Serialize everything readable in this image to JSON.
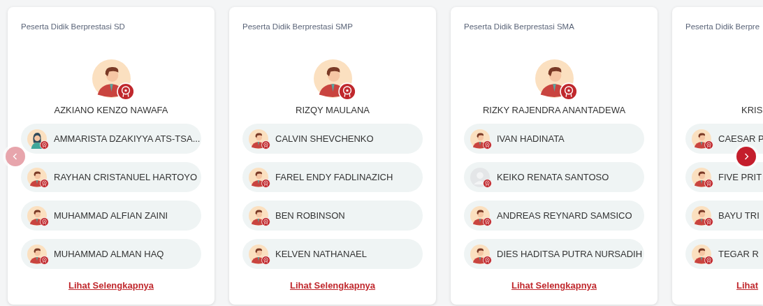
{
  "prev_button": {
    "disabled": true
  },
  "next_button": {
    "disabled": false
  },
  "cards": [
    {
      "title": "Peserta Didik Berprestasi SD",
      "featured": {
        "name": "AZKIANO KENZO NAWAFA",
        "kind": "boy"
      },
      "students": [
        {
          "name": "AMMARISTA DZAKIYYA ATS-TSA...",
          "kind": "girl"
        },
        {
          "name": "RAYHAN CRISTANUEL HARTOYO",
          "kind": "boy"
        },
        {
          "name": "MUHAMMAD ALFIAN ZAINI",
          "kind": "boy"
        },
        {
          "name": "MUHAMMAD ALMAN HAQ",
          "kind": "boy"
        }
      ],
      "link": "Lihat Selengkapnya"
    },
    {
      "title": "Peserta Didik Berprestasi SMP",
      "featured": {
        "name": "RIZQY MAULANA",
        "kind": "boy"
      },
      "students": [
        {
          "name": "CALVIN SHEVCHENKO",
          "kind": "boy"
        },
        {
          "name": "FAREL ENDY FADLINAZICH",
          "kind": "boy"
        },
        {
          "name": "BEN ROBINSON",
          "kind": "boy"
        },
        {
          "name": "KELVEN NATHANAEL",
          "kind": "boy"
        }
      ],
      "link": "Lihat Selengkapnya"
    },
    {
      "title": "Peserta Didik Berprestasi SMA",
      "featured": {
        "name": "RIZKY RAJENDRA ANANTADEWA",
        "kind": "boy"
      },
      "students": [
        {
          "name": "IVAN HADINATA",
          "kind": "boy"
        },
        {
          "name": "KEIKO RENATA SANTOSO",
          "kind": "blank"
        },
        {
          "name": "ANDREAS REYNARD SAMSICO",
          "kind": "boy"
        },
        {
          "name": "DIES HADITSA PUTRA NURSADIH",
          "kind": "boy"
        }
      ],
      "link": "Lihat Selengkapnya"
    },
    {
      "title": "Peserta Didik Berpre",
      "featured": {
        "name": "KRIS"
      },
      "students": [
        {
          "name": "CAESAR P",
          "kind": "boy"
        },
        {
          "name": "FIVE PRIT",
          "kind": "boy"
        },
        {
          "name": "BAYU TRI",
          "kind": "boy"
        },
        {
          "name": "TEGAR R",
          "kind": "boy"
        }
      ],
      "link": "Lihat"
    }
  ]
}
